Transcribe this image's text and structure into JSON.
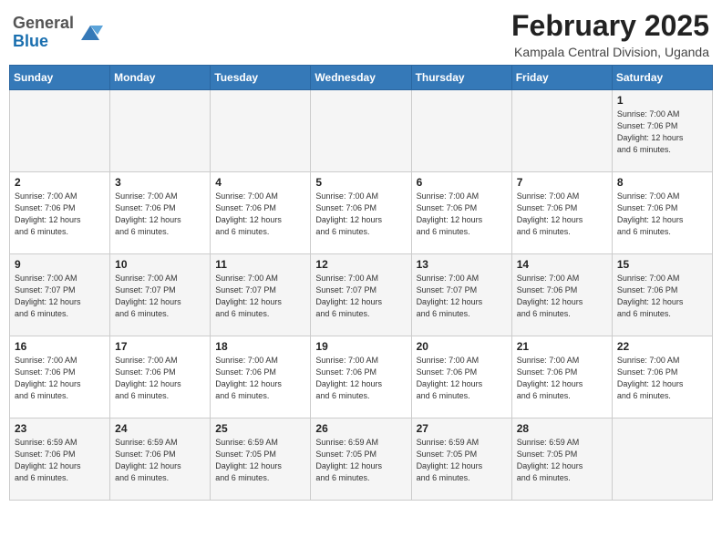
{
  "header": {
    "logo": {
      "general": "General",
      "blue": "Blue"
    },
    "title": "February 2025",
    "location": "Kampala Central Division, Uganda"
  },
  "weekdays": [
    "Sunday",
    "Monday",
    "Tuesday",
    "Wednesday",
    "Thursday",
    "Friday",
    "Saturday"
  ],
  "weeks": [
    [
      {
        "day": "",
        "info": ""
      },
      {
        "day": "",
        "info": ""
      },
      {
        "day": "",
        "info": ""
      },
      {
        "day": "",
        "info": ""
      },
      {
        "day": "",
        "info": ""
      },
      {
        "day": "",
        "info": ""
      },
      {
        "day": "1",
        "info": "Sunrise: 7:00 AM\nSunset: 7:06 PM\nDaylight: 12 hours\nand 6 minutes."
      }
    ],
    [
      {
        "day": "2",
        "info": "Sunrise: 7:00 AM\nSunset: 7:06 PM\nDaylight: 12 hours\nand 6 minutes."
      },
      {
        "day": "3",
        "info": "Sunrise: 7:00 AM\nSunset: 7:06 PM\nDaylight: 12 hours\nand 6 minutes."
      },
      {
        "day": "4",
        "info": "Sunrise: 7:00 AM\nSunset: 7:06 PM\nDaylight: 12 hours\nand 6 minutes."
      },
      {
        "day": "5",
        "info": "Sunrise: 7:00 AM\nSunset: 7:06 PM\nDaylight: 12 hours\nand 6 minutes."
      },
      {
        "day": "6",
        "info": "Sunrise: 7:00 AM\nSunset: 7:06 PM\nDaylight: 12 hours\nand 6 minutes."
      },
      {
        "day": "7",
        "info": "Sunrise: 7:00 AM\nSunset: 7:06 PM\nDaylight: 12 hours\nand 6 minutes."
      },
      {
        "day": "8",
        "info": "Sunrise: 7:00 AM\nSunset: 7:06 PM\nDaylight: 12 hours\nand 6 minutes."
      }
    ],
    [
      {
        "day": "9",
        "info": "Sunrise: 7:00 AM\nSunset: 7:07 PM\nDaylight: 12 hours\nand 6 minutes."
      },
      {
        "day": "10",
        "info": "Sunrise: 7:00 AM\nSunset: 7:07 PM\nDaylight: 12 hours\nand 6 minutes."
      },
      {
        "day": "11",
        "info": "Sunrise: 7:00 AM\nSunset: 7:07 PM\nDaylight: 12 hours\nand 6 minutes."
      },
      {
        "day": "12",
        "info": "Sunrise: 7:00 AM\nSunset: 7:07 PM\nDaylight: 12 hours\nand 6 minutes."
      },
      {
        "day": "13",
        "info": "Sunrise: 7:00 AM\nSunset: 7:07 PM\nDaylight: 12 hours\nand 6 minutes."
      },
      {
        "day": "14",
        "info": "Sunrise: 7:00 AM\nSunset: 7:06 PM\nDaylight: 12 hours\nand 6 minutes."
      },
      {
        "day": "15",
        "info": "Sunrise: 7:00 AM\nSunset: 7:06 PM\nDaylight: 12 hours\nand 6 minutes."
      }
    ],
    [
      {
        "day": "16",
        "info": "Sunrise: 7:00 AM\nSunset: 7:06 PM\nDaylight: 12 hours\nand 6 minutes."
      },
      {
        "day": "17",
        "info": "Sunrise: 7:00 AM\nSunset: 7:06 PM\nDaylight: 12 hours\nand 6 minutes."
      },
      {
        "day": "18",
        "info": "Sunrise: 7:00 AM\nSunset: 7:06 PM\nDaylight: 12 hours\nand 6 minutes."
      },
      {
        "day": "19",
        "info": "Sunrise: 7:00 AM\nSunset: 7:06 PM\nDaylight: 12 hours\nand 6 minutes."
      },
      {
        "day": "20",
        "info": "Sunrise: 7:00 AM\nSunset: 7:06 PM\nDaylight: 12 hours\nand 6 minutes."
      },
      {
        "day": "21",
        "info": "Sunrise: 7:00 AM\nSunset: 7:06 PM\nDaylight: 12 hours\nand 6 minutes."
      },
      {
        "day": "22",
        "info": "Sunrise: 7:00 AM\nSunset: 7:06 PM\nDaylight: 12 hours\nand 6 minutes."
      }
    ],
    [
      {
        "day": "23",
        "info": "Sunrise: 6:59 AM\nSunset: 7:06 PM\nDaylight: 12 hours\nand 6 minutes."
      },
      {
        "day": "24",
        "info": "Sunrise: 6:59 AM\nSunset: 7:06 PM\nDaylight: 12 hours\nand 6 minutes."
      },
      {
        "day": "25",
        "info": "Sunrise: 6:59 AM\nSunset: 7:05 PM\nDaylight: 12 hours\nand 6 minutes."
      },
      {
        "day": "26",
        "info": "Sunrise: 6:59 AM\nSunset: 7:05 PM\nDaylight: 12 hours\nand 6 minutes."
      },
      {
        "day": "27",
        "info": "Sunrise: 6:59 AM\nSunset: 7:05 PM\nDaylight: 12 hours\nand 6 minutes."
      },
      {
        "day": "28",
        "info": "Sunrise: 6:59 AM\nSunset: 7:05 PM\nDaylight: 12 hours\nand 6 minutes."
      },
      {
        "day": "",
        "info": ""
      }
    ]
  ]
}
